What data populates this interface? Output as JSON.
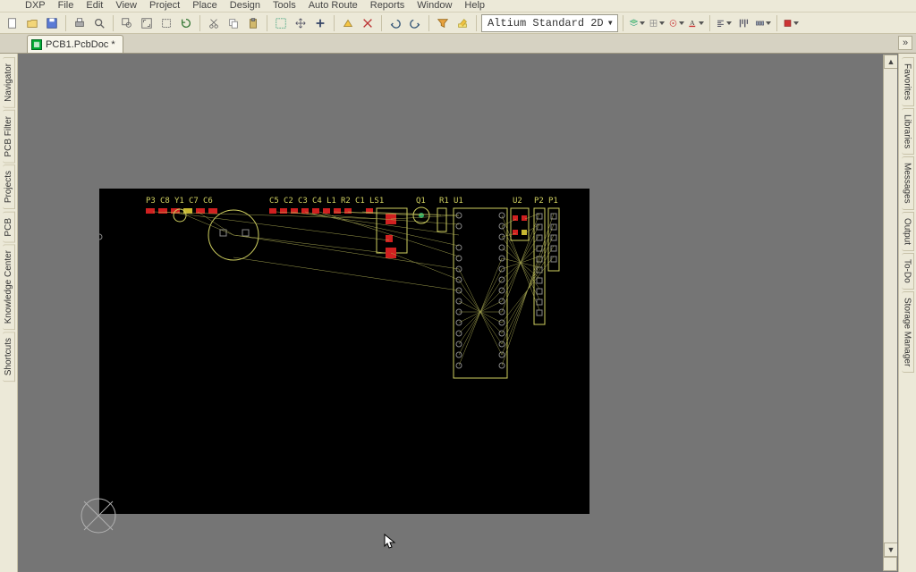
{
  "menus": {
    "m0": "DXP",
    "m1": "File",
    "m2": "Edit",
    "m3": "View",
    "m4": "Project",
    "m5": "Place",
    "m6": "Design",
    "m7": "Tools",
    "m8": "Auto Route",
    "m9": "Reports",
    "m10": "Window",
    "m11": "Help"
  },
  "toolbar": {
    "view_combo": "Altium Standard 2D"
  },
  "tab": {
    "name": "PCB1.PcbDoc *"
  },
  "left_panel": {
    "p0": "Navigator",
    "p1": "PCB Filter",
    "p2": "Projects",
    "p3": "PCB",
    "p4": "Knowledge Center",
    "p5": "Shortcuts"
  },
  "right_panel": {
    "p0": "Favorites",
    "p1": "Libraries",
    "p2": "Messages",
    "p3": "Output",
    "p4": "To-Do",
    "p5": "Storage Manager"
  },
  "designators": {
    "d0": "P3",
    "d1": "C8",
    "d2": "Y1",
    "d3": "C7",
    "d4": "C6",
    "d5": "C5",
    "d6": "C2",
    "d7": "C3",
    "d8": "C4",
    "d9": "L1",
    "d10": "R2",
    "d11": "C1",
    "d12": "LS1",
    "d13": "Q1",
    "d14": "R1",
    "d15": "U1",
    "d16": "U2",
    "d17": "P2",
    "d18": "P1"
  }
}
